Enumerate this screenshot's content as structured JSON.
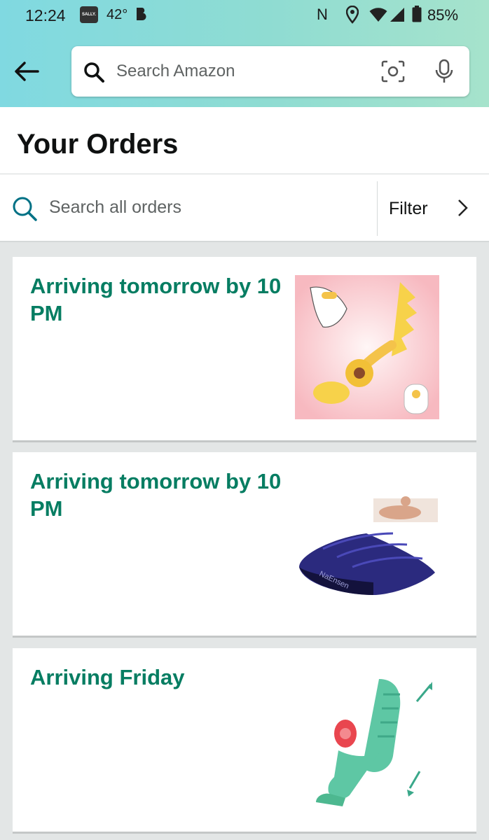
{
  "status_bar": {
    "time": "12:24",
    "sally_badge": "SALLY.",
    "temperature": "42°",
    "battery": "85%"
  },
  "search": {
    "placeholder": "Search Amazon"
  },
  "page": {
    "title": "Your Orders"
  },
  "order_search": {
    "placeholder": "Search all orders",
    "filter_label": "Filter"
  },
  "orders": [
    {
      "status": "Arriving tomorrow by 10 PM",
      "image": "product-thumbnail-yellow-toy"
    },
    {
      "status": "Arriving tomorrow by 10 PM",
      "image": "product-thumbnail-navy-wedge-pillow",
      "brand_text": "NaEnsen"
    },
    {
      "status": "Arriving Friday",
      "image": "product-thumbnail-teal-toy"
    }
  ],
  "colors": {
    "header_gradient_start": "#80d9e1",
    "header_gradient_end": "#a6e3cc",
    "status_green": "#067d62",
    "search_accent": "#007185"
  }
}
